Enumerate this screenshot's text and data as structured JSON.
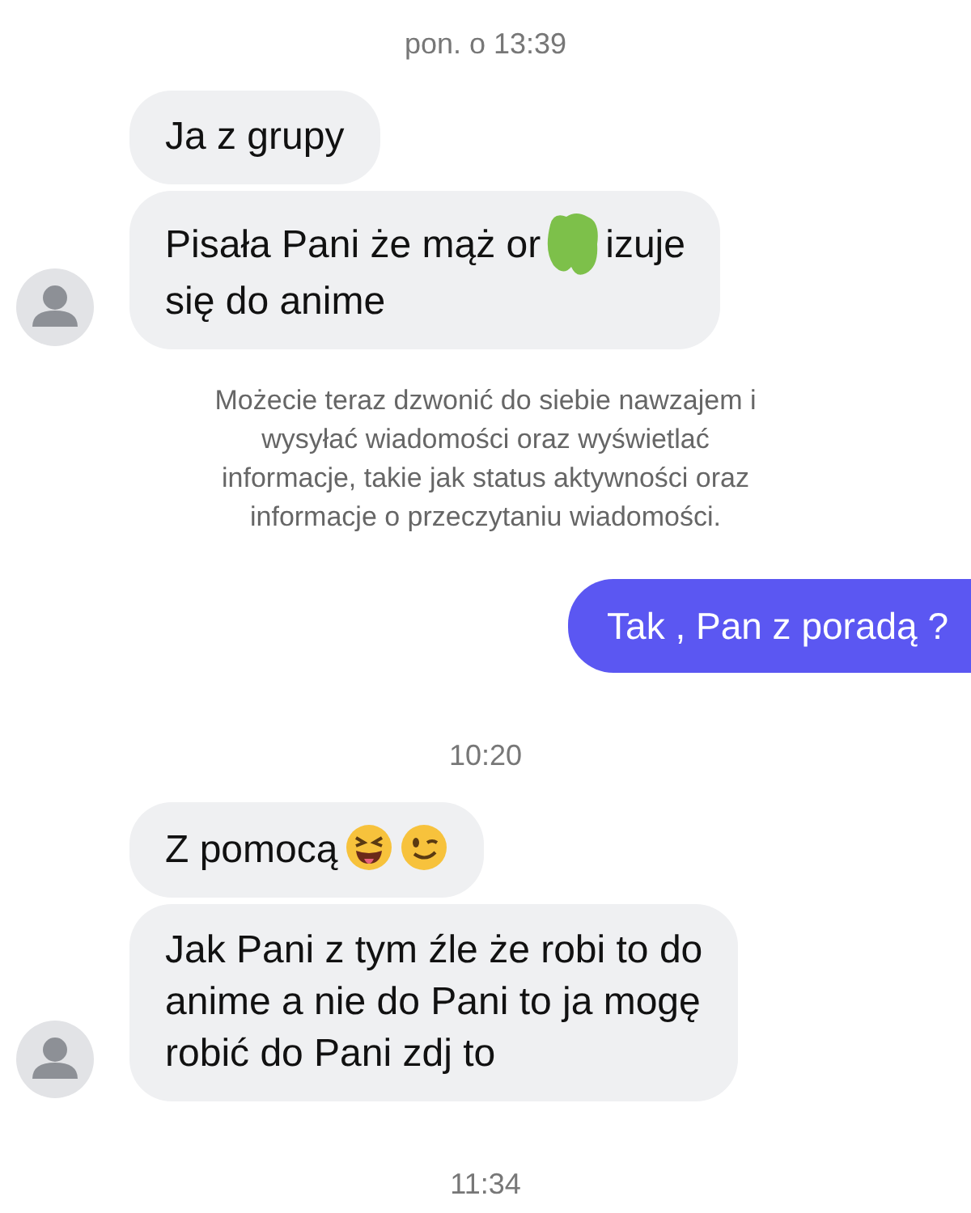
{
  "messages": [
    {
      "kind": "timestamp",
      "text": "pon. o 13:39"
    },
    {
      "kind": "incoming",
      "avatar": false,
      "parts": [
        {
          "kind": "text",
          "text": "Ja z grupy"
        }
      ]
    },
    {
      "kind": "incoming",
      "avatar": true,
      "parts": [
        {
          "kind": "text",
          "text": "Pisała Pani że mąż or"
        },
        {
          "kind": "redaction"
        },
        {
          "kind": "text",
          "text": "izuje"
        },
        {
          "kind": "text_line",
          "text": "się do anime"
        }
      ]
    },
    {
      "kind": "notice",
      "text": "Możecie teraz dzwonić do siebie nawzajem i\nwysyłać wiadomości oraz wyświetlać\ninformacje, takie jak status aktywności oraz\ninformacje o przeczytaniu wiadomości."
    },
    {
      "kind": "outgoing",
      "parts": [
        {
          "kind": "text",
          "text": "Tak , Pan z poradą ?"
        }
      ]
    },
    {
      "kind": "timestamp",
      "text": "10:20"
    },
    {
      "kind": "incoming",
      "avatar": false,
      "parts": [
        {
          "kind": "text",
          "text": "Z pomocą"
        },
        {
          "kind": "emoji"
        },
        {
          "kind": "emoji"
        }
      ]
    },
    {
      "kind": "incoming",
      "avatar": true,
      "parts": [
        {
          "kind": "text",
          "text": "Jak Pani z tym źle że robi to do\nanime a nie do Pani to ja mogę\nrobić do Pani zdj to"
        }
      ]
    },
    {
      "kind": "timestamp",
      "text": "11:34"
    }
  ]
}
